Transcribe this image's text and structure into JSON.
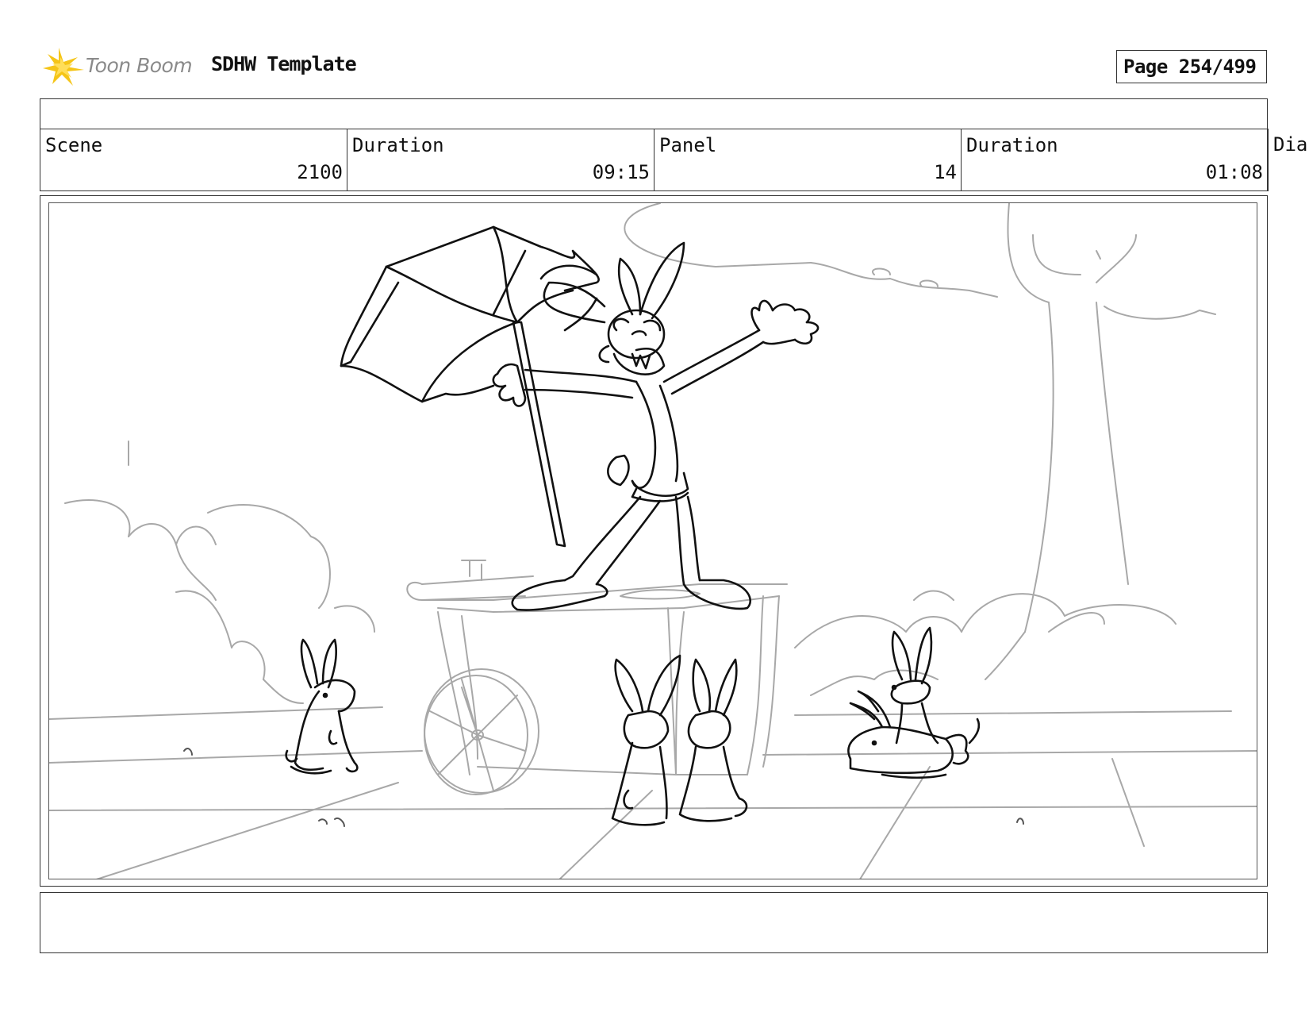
{
  "header": {
    "logo_text": "Toon Boom",
    "title": "SDHW Template",
    "page_label": "Page 254/499"
  },
  "info": {
    "scene_label": "Scene",
    "scene_value": "2100",
    "scene_duration_label": "Duration",
    "scene_duration_value": "09:15",
    "panel_label": "Panel",
    "panel_value": "14",
    "panel_duration_label": "Duration",
    "panel_duration_value": "01:08",
    "dialogue_label": "Dia"
  },
  "colors": {
    "logo_star": "#f5c518",
    "logo_text": "#8a8a8a",
    "sketch_black": "#111111",
    "sketch_grey": "#a8a8a8"
  }
}
